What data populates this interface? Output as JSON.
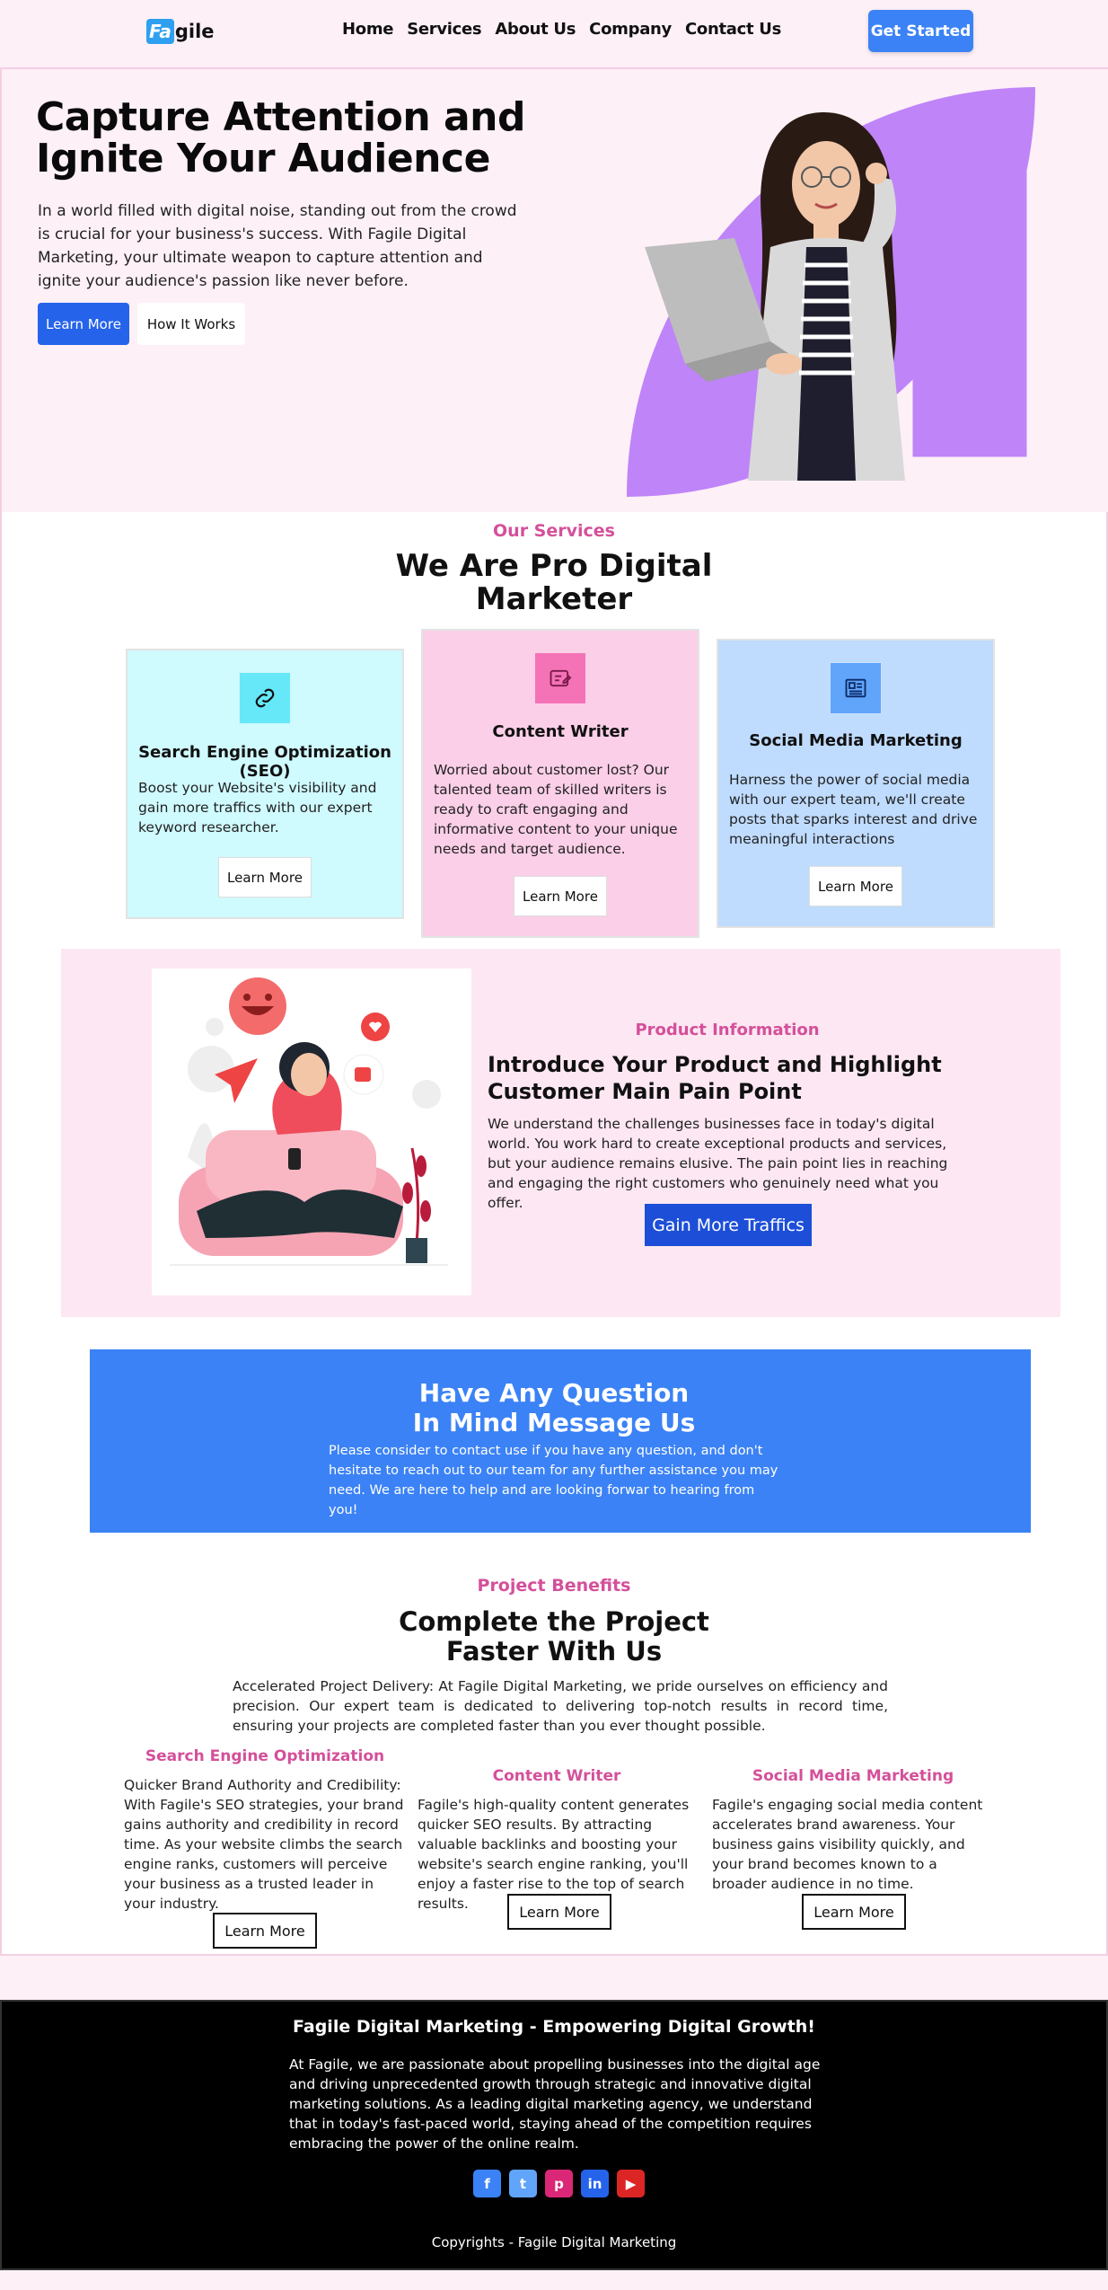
{
  "header": {
    "logo_mark": "Fa",
    "logo_rest": "gile",
    "nav": [
      "Home",
      "Services",
      "About Us",
      "Company",
      "Contact Us"
    ],
    "cta": "Get Started"
  },
  "hero": {
    "title": "Capture Attention and Ignite Your Audience",
    "text": "In a world filled with digital noise, standing out from the crowd is crucial for your business's success. With Fagile Digital Marketing, your ultimate weapon to capture attention and ignite your audience's passion like never before.",
    "primary_button": "Learn More",
    "secondary_button": "How It Works"
  },
  "services": {
    "eyebrow": "Our Services",
    "title": "We Are Pro Digital Marketer",
    "cards": [
      {
        "title": "Search Engine Optimization (SEO)",
        "text": "Boost your Website's visibility and gain more traffics with our expert keyword researcher.",
        "button": "Learn More",
        "icon": "link-icon",
        "bg": "#cffafe",
        "icon_bg": "#67e8f9"
      },
      {
        "title": "Content Writer",
        "text": "Worried about customer lost? Our talented team of skilled writers is ready to craft engaging and informative content to your unique needs and target audience.",
        "button": "Learn More",
        "icon": "pencil-note-icon",
        "bg": "#fbcfe8",
        "icon_bg": "#f472b6"
      },
      {
        "title": "Social Media Marketing",
        "text": "Harness the power of social media with our expert team, we'll create posts that sparks interest and drive meaningful interactions",
        "button": "Learn More",
        "icon": "newspaper-icon",
        "bg": "#bfdbfe",
        "icon_bg": "#60a5fa"
      }
    ]
  },
  "product": {
    "eyebrow": "Product Information",
    "title": "Introduce Your Product and Highlight Customer Main Pain Point",
    "text": "We understand the challenges businesses face in today's digital world. You work hard to create exceptional products and services, but your audience remains elusive. The pain point lies in reaching and engaging the right customers who genuinely need what you offer.",
    "button": "Gain More Traffics"
  },
  "contact": {
    "title_line1": "Have Any Question",
    "title_line2": "In Mind Message Us",
    "text": "Please consider to contact use if you have any question, and don't hesitate to reach out to our team for any further assistance you may need. We are here to help and are looking forwar to hearing from you!"
  },
  "benefits": {
    "eyebrow": "Project Benefits",
    "title": "Complete the Project Faster With Us",
    "text": "Accelerated Project Delivery: At Fagile Digital Marketing, we pride ourselves on efficiency and precision. Our expert team is dedicated to delivering top-notch results in record time, ensuring your projects are completed faster than you ever thought possible.",
    "items": [
      {
        "title": "Search Engine Optimization",
        "text": "Quicker Brand Authority and Credibility: With Fagile's SEO strategies, your brand gains authority and credibility in record time. As your website climbs the search engine ranks, customers will perceive your business as a trusted leader in your industry.",
        "button": "Learn More"
      },
      {
        "title": "Content Writer",
        "text": "Fagile's high-quality content generates quicker SEO results. By attracting valuable backlinks and boosting your website's search engine ranking, you'll enjoy a faster rise to the top of search results.",
        "button": "Learn More"
      },
      {
        "title": "Social Media Marketing",
        "text": "Fagile's engaging social media content accelerates brand awareness. Your business gains visibility quickly, and your brand becomes known to a broader audience in no time.",
        "button": "Learn More"
      }
    ]
  },
  "footer": {
    "title": "Fagile Digital Marketing - Empowering Digital Growth!",
    "text": "At Fagile, we are passionate about propelling businesses into the digital age and driving unprecedented growth through strategic and innovative digital marketing solutions. As a leading digital marketing agency, we understand that in today's fast-paced world, staying ahead of the competition requires embracing the power of the online realm.",
    "socials": [
      {
        "icon": "facebook-icon",
        "glyph": "f",
        "color": "#3b82f6"
      },
      {
        "icon": "twitter-icon",
        "glyph": "t",
        "color": "#60a5fa"
      },
      {
        "icon": "pinterest-icon",
        "glyph": "p",
        "color": "#db2777"
      },
      {
        "icon": "linkedin-icon",
        "glyph": "in",
        "color": "#2563eb"
      },
      {
        "icon": "youtube-icon",
        "glyph": "▶",
        "color": "#dc2626"
      }
    ],
    "copyright": "Copyrights - Fagile Digital Marketing"
  }
}
